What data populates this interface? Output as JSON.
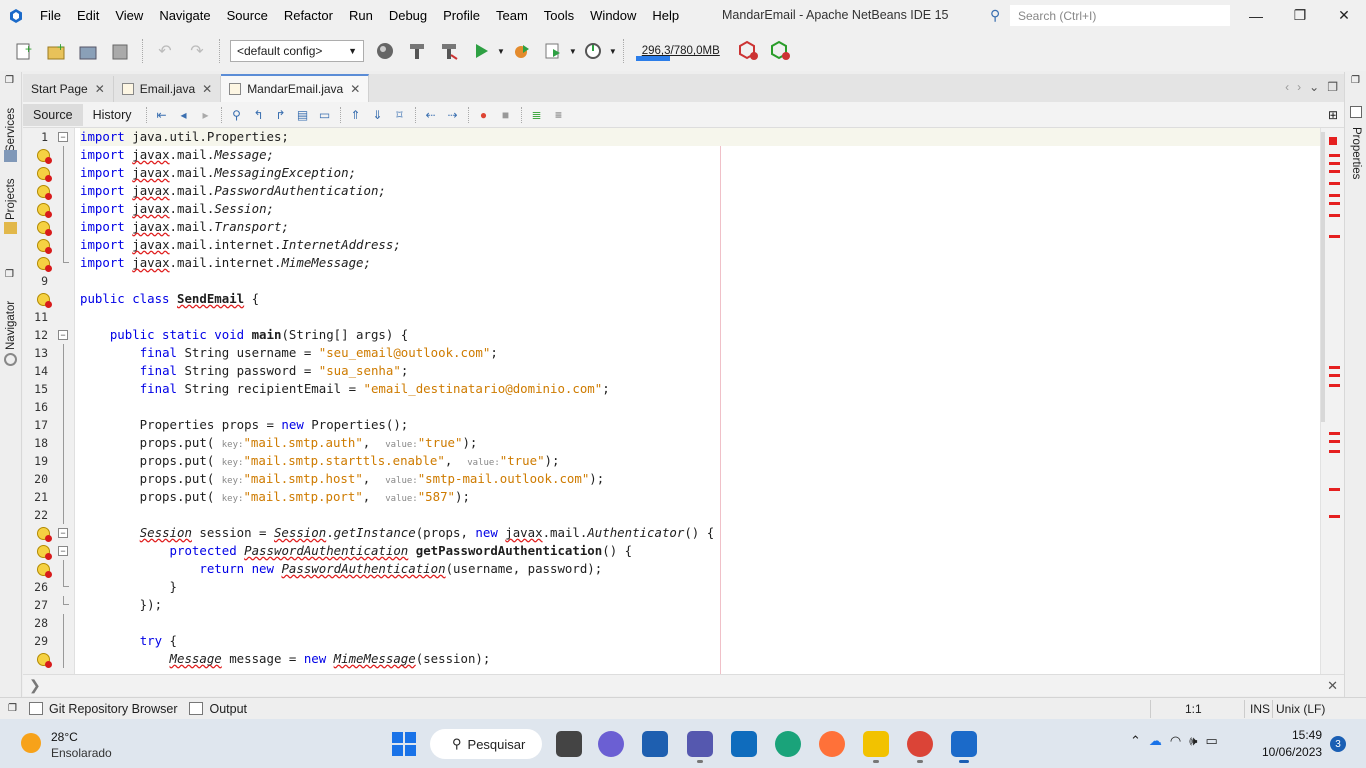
{
  "window": {
    "title": "MandarEmail - Apache NetBeans IDE 15",
    "search_placeholder": "Search (Ctrl+I)",
    "minimize": "—",
    "maximize": "❐",
    "close": "✕"
  },
  "menu": [
    "File",
    "Edit",
    "View",
    "Navigate",
    "Source",
    "Refactor",
    "Run",
    "Debug",
    "Profile",
    "Team",
    "Tools",
    "Window",
    "Help"
  ],
  "toolbar": {
    "config_value": "<default config>",
    "memory_label": "296,3/780,0MB",
    "memory_fraction": 0.38
  },
  "side_tabs": {
    "left": [
      "Services",
      "Projects",
      "Navigator"
    ],
    "right": [
      "Properties"
    ]
  },
  "editor_tabs": [
    {
      "label": "Start Page",
      "active": false
    },
    {
      "label": "Email.java",
      "active": false
    },
    {
      "label": "MandarEmail.java",
      "active": true
    }
  ],
  "source_tabs": {
    "source": "Source",
    "history": "History"
  },
  "code_lines": [
    {
      "n": "1",
      "warn": false,
      "fold": "open"
    },
    {
      "n": "",
      "warn": true,
      "fold": "line"
    },
    {
      "n": "",
      "warn": true,
      "fold": "line"
    },
    {
      "n": "",
      "warn": true,
      "fold": "line"
    },
    {
      "n": "",
      "warn": true,
      "fold": "line"
    },
    {
      "n": "",
      "warn": true,
      "fold": "line"
    },
    {
      "n": "",
      "warn": true,
      "fold": "line"
    },
    {
      "n": "",
      "warn": true,
      "fold": "end"
    },
    {
      "n": "9",
      "warn": false,
      "fold": ""
    },
    {
      "n": "",
      "warn": true,
      "fold": ""
    },
    {
      "n": "11",
      "warn": false,
      "fold": ""
    },
    {
      "n": "12",
      "warn": false,
      "fold": "open"
    },
    {
      "n": "13",
      "warn": false,
      "fold": "line"
    },
    {
      "n": "14",
      "warn": false,
      "fold": "line"
    },
    {
      "n": "15",
      "warn": false,
      "fold": "line"
    },
    {
      "n": "16",
      "warn": false,
      "fold": "line"
    },
    {
      "n": "17",
      "warn": false,
      "fold": "line"
    },
    {
      "n": "18",
      "warn": false,
      "fold": "line"
    },
    {
      "n": "19",
      "warn": false,
      "fold": "line"
    },
    {
      "n": "20",
      "warn": false,
      "fold": "line"
    },
    {
      "n": "21",
      "warn": false,
      "fold": "line"
    },
    {
      "n": "22",
      "warn": false,
      "fold": "line"
    },
    {
      "n": "",
      "warn": true,
      "fold": "open"
    },
    {
      "n": "",
      "warn": true,
      "fold": "open"
    },
    {
      "n": "",
      "warn": true,
      "fold": "line"
    },
    {
      "n": "26",
      "warn": false,
      "fold": "end"
    },
    {
      "n": "27",
      "warn": false,
      "fold": "end"
    },
    {
      "n": "28",
      "warn": false,
      "fold": "line"
    },
    {
      "n": "29",
      "warn": false,
      "fold": "line"
    },
    {
      "n": "",
      "warn": true,
      "fold": "line"
    }
  ],
  "code": {
    "l1": "java.util.Properties;",
    "l2": "Message;",
    "l3": "MessagingException;",
    "l4": "PasswordAuthentication;",
    "l5": "Session;",
    "l6": "Transport;",
    "l7": "InternetAddress;",
    "l8": "MimeMessage;",
    "class_name": "SendEmail",
    "username": "\"seu_email@outlook.com\"",
    "password": "\"sua_senha\"",
    "recipient": "\"email_destinatario@dominio.com\"",
    "k1": "\"mail.smtp.auth\"",
    "v1": "\"true\"",
    "k2": "\"mail.smtp.starttls.enable\"",
    "v2": "\"true\"",
    "k3": "\"mail.smtp.host\"",
    "v3": "\"smtp-mail.outlook.com\"",
    "k4": "\"mail.smtp.port\"",
    "v4": "\"587\""
  },
  "status": {
    "git_tab": "Git Repository Browser",
    "output_tab": "Output",
    "position": "1:1",
    "mode": "INS",
    "eol": "Unix (LF)"
  },
  "taskbar": {
    "temp": "28°C",
    "weather": "Ensolarado",
    "search": "Pesquisar",
    "time": "15:49",
    "date": "10/06/2023",
    "notifications": "3"
  }
}
